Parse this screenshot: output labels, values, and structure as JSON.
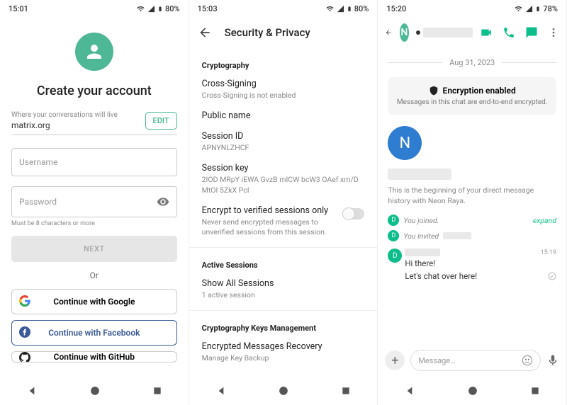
{
  "screen1": {
    "status": {
      "time": "15:01",
      "battery": "80%"
    },
    "title": "Create your account",
    "server_label": "Where your conversations will live",
    "server_name": "matrix.org",
    "edit_label": "EDIT",
    "username_placeholder": "Username",
    "password_placeholder": "Password",
    "password_helper": "Must be 8 characters or more",
    "next_label": "NEXT",
    "or_label": "Or",
    "sso_google": "Continue with Google",
    "sso_facebook": "Continue with Facebook",
    "sso_github": "Continue with GitHub"
  },
  "screen2": {
    "status": {
      "time": "15:03",
      "battery": "80%"
    },
    "header": "Security & Privacy",
    "sections": {
      "crypto": {
        "heading": "Cryptography",
        "cross_signing": {
          "title": "Cross-Signing",
          "sub": "Cross-Signing is not enabled"
        },
        "public_name": {
          "title": "Public name"
        },
        "session_id": {
          "title": "Session ID",
          "sub": "APNYNLZHCF"
        },
        "session_key": {
          "title": "Session key",
          "sub": "2IOD MRpY iEWA GvzB mICW bcW3 OAef xm/D MtOI 5ZkX PcI"
        },
        "encrypt_verified": {
          "title": "Encrypt to verified sessions only",
          "sub": "Never send encrypted messages to unverified sessions from this session."
        }
      },
      "active": {
        "heading": "Active Sessions",
        "show_all": {
          "title": "Show All Sessions",
          "sub": "1 active session"
        }
      },
      "keys": {
        "heading": "Cryptography Keys Management",
        "recovery": {
          "title": "Encrypted Messages Recovery",
          "sub": "Manage Key Backup"
        }
      }
    }
  },
  "screen3": {
    "status": {
      "time": "15:20",
      "battery": "78%"
    },
    "avatar_initial": "N",
    "date": "Aug 31, 2023",
    "encryption": {
      "title": "Encryption enabled",
      "sub": "Messages in this chat are end-to-end encrypted."
    },
    "big_avatar_initial": "N",
    "beginning_text": "This is the beginning of your direct message history with Neon Raya.",
    "sys_joined": "You joined.",
    "sys_invited": "You invited",
    "expand_label": "expand",
    "badge_initial": "D",
    "msg_time": "15:19",
    "msg1": "Hi there!",
    "msg2": "Let's chat over here!",
    "composer_placeholder": "Message…"
  }
}
